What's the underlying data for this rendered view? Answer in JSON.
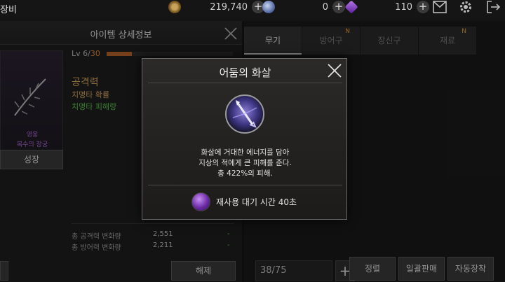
{
  "topbar": {
    "title": "장비",
    "resources": [
      {
        "name": "gold",
        "value": "219,740"
      },
      {
        "name": "crystal",
        "value": "0"
      },
      {
        "name": "gem",
        "value": "110"
      }
    ],
    "plus_label": "+"
  },
  "item_detail": {
    "title": "아이템 상세정보",
    "grade": "영웅",
    "item_name": "복수의 장궁",
    "grow_label": "성장",
    "level": {
      "prefix": "Lv 6/",
      "max": "30",
      "progress": 0.2
    },
    "stat_attack": "공격력",
    "stat_crit": "치명타 확률",
    "stat_crit_damage": "치명타 피해량",
    "summary": [
      {
        "label": "총 공격력 변화량",
        "value": "2,551",
        "diff": "-"
      },
      {
        "label": "총 방어력 변화량",
        "value": "2,211",
        "diff": "-"
      }
    ],
    "release_label": "해제"
  },
  "inventory": {
    "tabs": [
      {
        "label": "무기",
        "active": true,
        "new": ""
      },
      {
        "label": "방어구",
        "active": false,
        "new": "N"
      },
      {
        "label": "장신구",
        "active": false,
        "new": ""
      },
      {
        "label": "재료",
        "active": false,
        "new": "N"
      }
    ],
    "count": "38/75",
    "add_label": "+",
    "sort_label": "정렬",
    "bulk_sell_label": "일괄판매",
    "auto_equip_label": "자동장착"
  },
  "skill_modal": {
    "title": "어둠의 화살",
    "desc_line1": "화살에 거대한 에너지를 담아",
    "desc_line2": "지상의 적에게 큰 피해를 준다.",
    "desc_line3": "총 422%의 피해.",
    "cooldown_text": "재사용 대기 시간 40초"
  }
}
